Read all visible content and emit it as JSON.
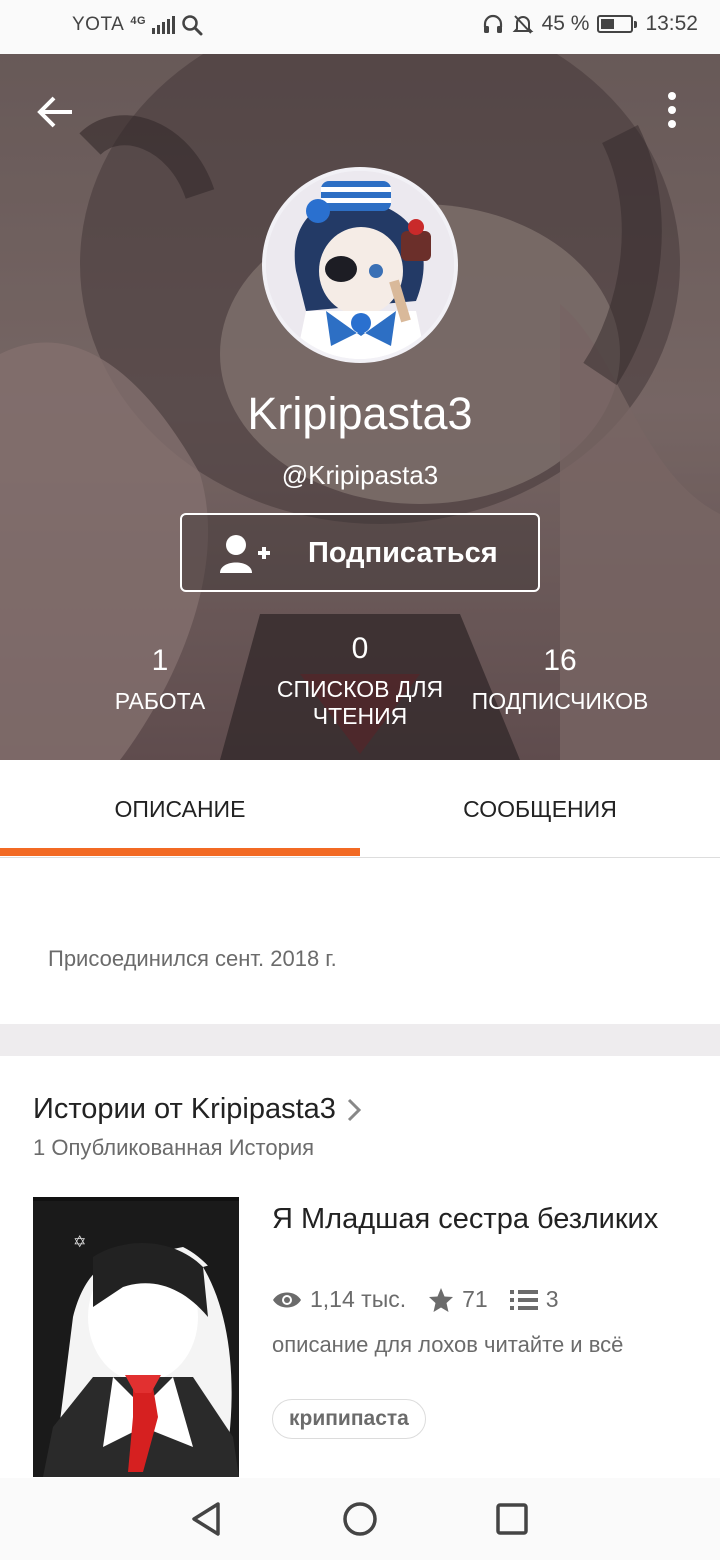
{
  "status_bar": {
    "carrier": "YOTA",
    "network": "4G",
    "battery": "45 %",
    "battery_level": 0.45,
    "time": "13:52",
    "icons": [
      "signal-icon",
      "search-icon",
      "headphones-icon",
      "bell-muted-icon",
      "battery-icon"
    ]
  },
  "header": {
    "back_icon": "arrow-left-icon",
    "menu_icon": "more-vertical-icon"
  },
  "profile": {
    "name": "Kripipasta3",
    "handle": "@Kripipasta3",
    "follow_label": "Подписаться",
    "follow_icon": "add-user-icon"
  },
  "stats": [
    {
      "value": "1",
      "label": "РАБОТА"
    },
    {
      "value": "0",
      "label_line1": "СПИСКОВ ДЛЯ",
      "label_line2": "ЧТЕНИЯ"
    },
    {
      "value": "16",
      "label": "ПОДПИСЧИКОВ"
    }
  ],
  "tabs": [
    {
      "label": "ОПИСАНИЕ",
      "active": true
    },
    {
      "label": "СООБЩЕНИЯ",
      "active": false
    }
  ],
  "accent_color": "#f26a24",
  "about": {
    "joined": "Присоединился сент. 2018 г."
  },
  "stories": {
    "title": "Истории от Kripipasta3",
    "subtitle": "1 Опубликованная История",
    "items": [
      {
        "title": "Я Младшая сестра безликих",
        "reads": "1,14 тыс.",
        "votes": "71",
        "parts": "3",
        "description": "описание для лохов читайте и всё",
        "tag": "крипипаста"
      }
    ]
  },
  "navbar": {
    "icons": [
      "back-triangle-icon",
      "home-circle-icon",
      "recents-square-icon"
    ]
  }
}
